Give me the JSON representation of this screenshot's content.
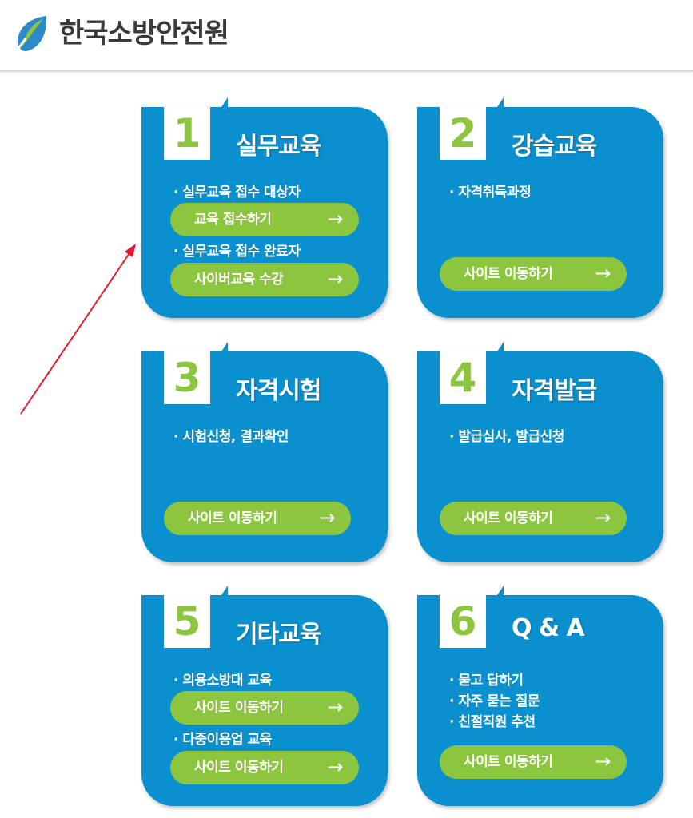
{
  "header": {
    "logo_text": "한국소방안전원"
  },
  "cards": [
    {
      "number": "1",
      "title": "실무교육",
      "items": [
        "· 실무교육 접수 대상자",
        "· 실무교육 접수 완료자"
      ],
      "buttons": [
        "교육 접수하기",
        "사이버교육 수강"
      ]
    },
    {
      "number": "2",
      "title": "강습교육",
      "items": [
        "· 자격취득과정"
      ],
      "buttons": [
        "사이트 이동하기"
      ]
    },
    {
      "number": "3",
      "title": "자격시험",
      "items": [
        "· 시험신청, 결과확인"
      ],
      "buttons": [
        "사이트 이동하기"
      ]
    },
    {
      "number": "4",
      "title": "자격발급",
      "items": [
        "· 발급심사, 발급신청"
      ],
      "buttons": [
        "사이트 이동하기"
      ]
    },
    {
      "number": "5",
      "title": "기타교육",
      "items": [
        "· 의용소방대 교육",
        "· 다중이용업 교육"
      ],
      "buttons": [
        "사이트 이동하기",
        "사이트 이동하기"
      ]
    },
    {
      "number": "6",
      "title": "Q & A",
      "items": [
        "· 묻고 답하기",
        "· 자주 묻는 질문",
        "· 친절직원 추천"
      ],
      "buttons": [
        "사이트 이동하기"
      ]
    }
  ],
  "arrow_glyph": "→",
  "colors": {
    "card_blue": "#0a90cf",
    "accent_green": "#8cc63f",
    "annotation_red": "#e8192c"
  }
}
